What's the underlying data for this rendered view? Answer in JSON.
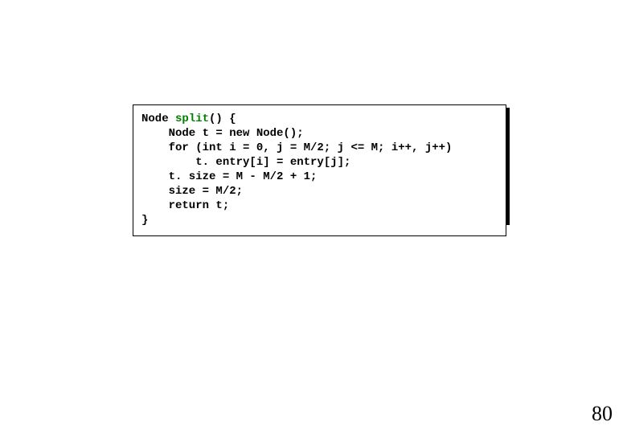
{
  "code": {
    "line1_pre": "Node ",
    "line1_method": "split",
    "line1_post": "() {",
    "line2": "    Node t = new Node();",
    "line3": "    for (int i = 0, j = M/2; j <= M; i++, j++)",
    "line4": "        t. entry[i] = entry[j];",
    "line5": "    t. size = M - M/2 + 1;",
    "line6": "    size = M/2;",
    "line7": "    return t;",
    "line8": "}"
  },
  "page_number": "80"
}
